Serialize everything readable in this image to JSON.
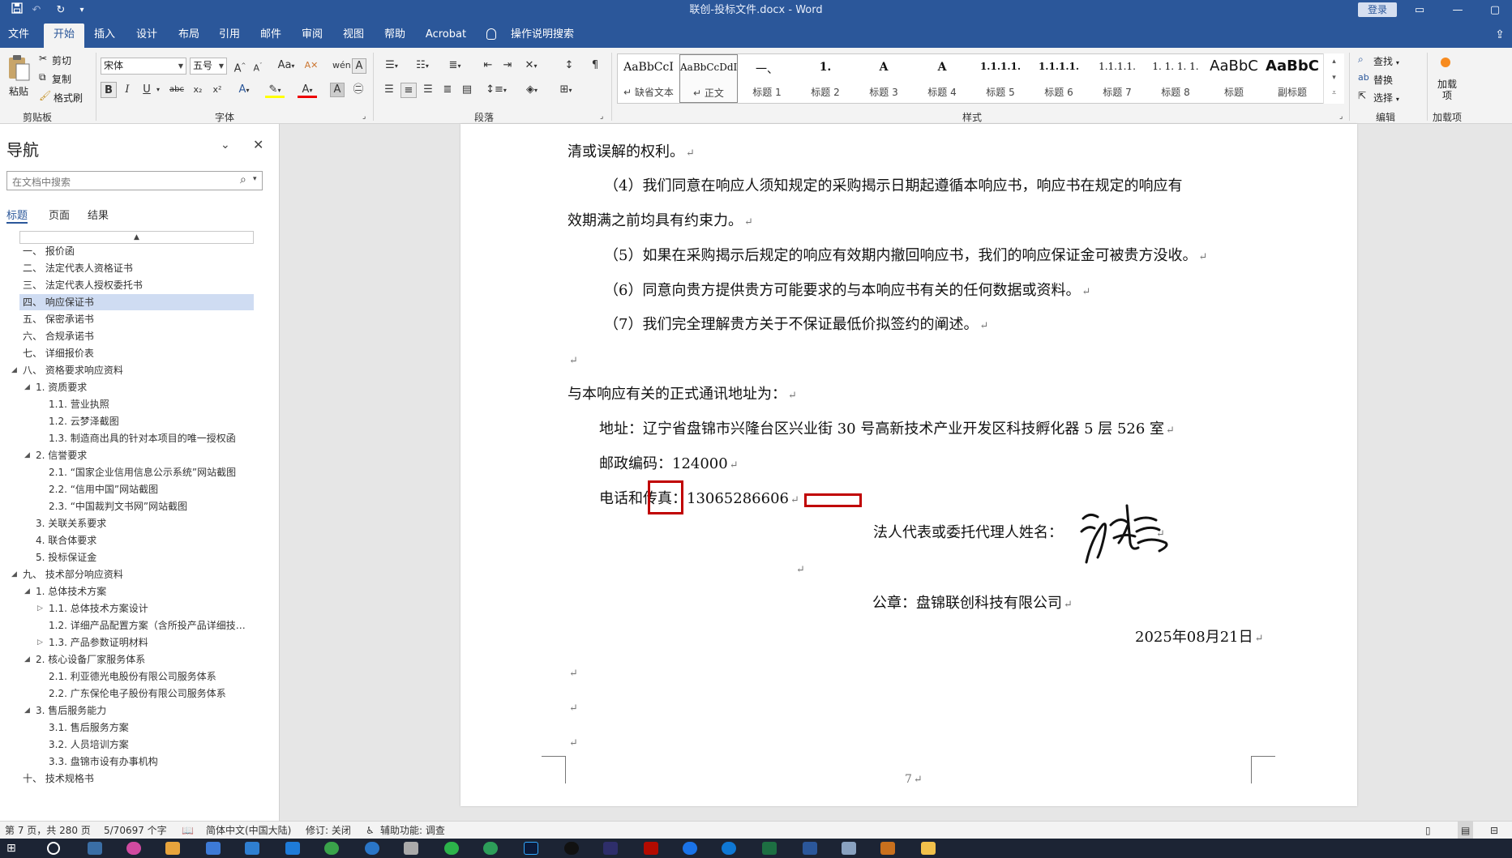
{
  "titlebar": {
    "title": "联创-投标文件.docx  -  Word",
    "login_label": "登录",
    "save_icon": "save-icon",
    "undo_icon": "undo-icon",
    "redo_icon": "redo-icon"
  },
  "tabs": [
    "文件",
    "开始",
    "插入",
    "设计",
    "布局",
    "引用",
    "邮件",
    "审阅",
    "视图",
    "帮助",
    "Acrobat"
  ],
  "active_tab": "开始",
  "tell_me": "操作说明搜索",
  "ribbon": {
    "clipboard": {
      "paste": "粘贴",
      "cut": "剪切",
      "copy": "复制",
      "format_painter": "格式刷",
      "label": "剪贴板"
    },
    "font": {
      "name": "宋体",
      "size": "五号",
      "label": "字体",
      "case_label": "Aa"
    },
    "paragraph": {
      "label": "段落"
    },
    "styles": {
      "label": "样式",
      "items": [
        {
          "preview": "AaBbCcI",
          "name": "缺省文本"
        },
        {
          "preview": "AaBbCcDdI",
          "name": "正文"
        },
        {
          "preview": "一、",
          "name": "标题 1"
        },
        {
          "preview": "1.",
          "name": "标题 2"
        },
        {
          "preview": "A",
          "name": "标题 3"
        },
        {
          "preview": "A",
          "name": "标题 4"
        },
        {
          "preview": "1.1.1.1.",
          "name": "标题 5"
        },
        {
          "preview": "1.1.1.1.",
          "name": "标题 6"
        },
        {
          "preview": "1.1.1.1.",
          "name": "标题 7"
        },
        {
          "preview": "1. 1. 1. 1.",
          "name": "标题 8"
        },
        {
          "preview": "AaBbC",
          "name": "标题"
        },
        {
          "preview": "AaBbC",
          "name": "副标题"
        }
      ]
    },
    "editing": {
      "find": "查找",
      "replace": "替换",
      "select": "选择",
      "label": "编辑"
    },
    "addins": {
      "button": "加载项",
      "label": "加载项"
    }
  },
  "nav": {
    "title": "导航",
    "search_placeholder": "在文档中搜索",
    "tabs": [
      "标题",
      "页面",
      "结果"
    ],
    "items": [
      {
        "text": "一、  报价函",
        "level": 0
      },
      {
        "text": "二、  法定代表人资格证书",
        "level": 0
      },
      {
        "text": "三、  法定代表人授权委托书",
        "level": 0
      },
      {
        "text": "四、  响应保证书",
        "level": 0
      },
      {
        "text": "五、  保密承诺书",
        "level": 0
      },
      {
        "text": "六、  合规承诺书",
        "level": 0
      },
      {
        "text": "七、  详细报价表",
        "level": 0
      },
      {
        "text": "八、  资格要求响应资料",
        "level": 0
      },
      {
        "text": "1. 资质要求",
        "level": 1
      },
      {
        "text": "1.1. 营业执照",
        "level": 2
      },
      {
        "text": "1.2. 云梦泽截图",
        "level": 2
      },
      {
        "text": "1.3. 制造商出具的针对本项目的唯一授权函",
        "level": 2
      },
      {
        "text": "2. 信誉要求",
        "level": 1
      },
      {
        "text": "2.1. “国家企业信用信息公示系统”网站截图",
        "level": 2
      },
      {
        "text": "2.2. “信用中国”网站截图",
        "level": 2
      },
      {
        "text": "2.3. “中国裁判文书网”网站截图",
        "level": 2
      },
      {
        "text": "3. 关联关系要求",
        "level": 1
      },
      {
        "text": "4. 联合体要求",
        "level": 1
      },
      {
        "text": "5. 投标保证金",
        "level": 1
      },
      {
        "text": "九、  技术部分响应资料",
        "level": 0
      },
      {
        "text": "1. 总体技术方案",
        "level": 1
      },
      {
        "text": "1.1. 总体技术方案设计",
        "level": 2
      },
      {
        "text": "1.2. 详细产品配置方案（含所投产品详细技…",
        "level": 2
      },
      {
        "text": "1.3. 产品参数证明材料",
        "level": 2
      },
      {
        "text": "2. 核心设备厂家服务体系",
        "level": 1
      },
      {
        "text": "2.1. 利亚德光电股份有限公司服务体系",
        "level": 2
      },
      {
        "text": "2.2. 广东保伦电子股份有限公司服务体系",
        "level": 2
      },
      {
        "text": "3. 售后服务能力",
        "level": 1
      },
      {
        "text": "3.1. 售后服务方案",
        "level": 2
      },
      {
        "text": "3.2. 人员培训方案",
        "level": 2
      },
      {
        "text": "3.3. 盘锦市设有办事机构",
        "level": 2
      },
      {
        "text": "十、  技术规格书",
        "level": 0
      }
    ]
  },
  "document": {
    "p1": "清或误解的权利。",
    "p2a": "（4）我们同意在响应人须知规定的采购揭示日期起遵循本响应书，响应书在规定的响应有",
    "p2b": "效期满之前均具有约束力。",
    "p3": "（5）如果在采购揭示后规定的响应有效期内撤回响应书，我们的响应保证金可被贵方没收。",
    "p4": "（6）同意向贵方提供贵方可能要求的与本响应书有关的任何数据或资料。",
    "p5": "（7）我们完全理解贵方关于不保证最低价拟签约的阐述。",
    "p6": "与本响应有关的正式通讯地址为：",
    "address": "地址：辽宁省盘锦市兴隆台区兴业街 30 号高新技术产业开发区科技孵化器 5 层 526 室",
    "postcode": "邮政编码：124000",
    "phone": "电话和传真：13065286606",
    "signer": "法人代表或委托代理人姓名：",
    "seal": "公章：盘锦联创科技有限公司",
    "date": "2025年08月21日",
    "page_number": "7",
    "para_mark": "↵"
  },
  "status": {
    "page": "第 7 页，共 280 页",
    "words": "5/70697 个字",
    "language": "简体中文(中国大陆)",
    "track": "修订: 关闭",
    "accessibility": "辅助功能: 调查"
  }
}
